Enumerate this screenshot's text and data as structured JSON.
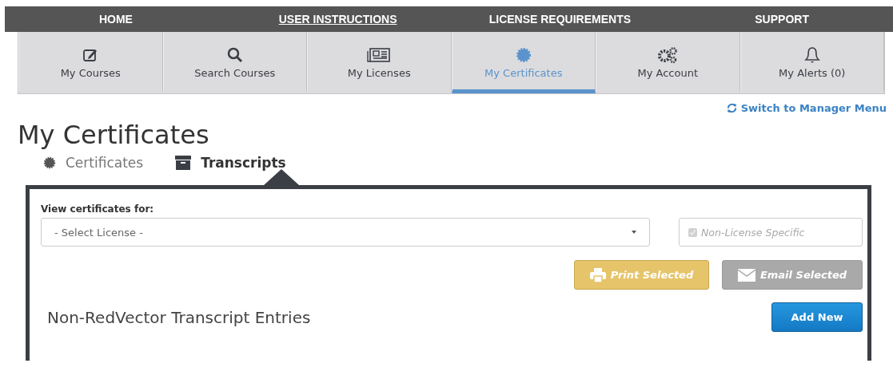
{
  "top_nav": [
    {
      "label": "HOME",
      "active": false
    },
    {
      "label": "USER INSTRUCTIONS",
      "active": true
    },
    {
      "label": "LICENSE REQUIREMENTS",
      "active": false
    },
    {
      "label": "SUPPORT",
      "active": false
    }
  ],
  "main_tabs": [
    {
      "kind": "edit",
      "label": "My Courses",
      "selected": false
    },
    {
      "kind": "search",
      "label": "Search Courses",
      "selected": false
    },
    {
      "kind": "license",
      "label": "My Licenses",
      "selected": false
    },
    {
      "kind": "certificate",
      "label": "My Certificates",
      "selected": true
    },
    {
      "kind": "gears",
      "label": "My Account",
      "selected": false
    },
    {
      "kind": "bell",
      "label": "My Alerts (0)",
      "selected": false
    }
  ],
  "switch_link": "Switch to Manager Menu",
  "page_title": "My Certificates",
  "sub_tabs": [
    {
      "kind": "certificate",
      "label": "Certificates",
      "selected": false
    },
    {
      "kind": "archive",
      "label": "Transcripts",
      "selected": true
    }
  ],
  "panel": {
    "filter_label": "View certificates for:",
    "license_select": {
      "value": "- Select License -"
    },
    "non_license_checkbox": {
      "label": "Non-License Specific",
      "checked": true,
      "disabled": true
    },
    "actions": [
      {
        "kind": "print",
        "label": "Print Selected"
      },
      {
        "kind": "email",
        "label": "Email Selected"
      }
    ],
    "section_title": "Non-RedVector Transcript Entries",
    "add_button": "Add New"
  }
}
